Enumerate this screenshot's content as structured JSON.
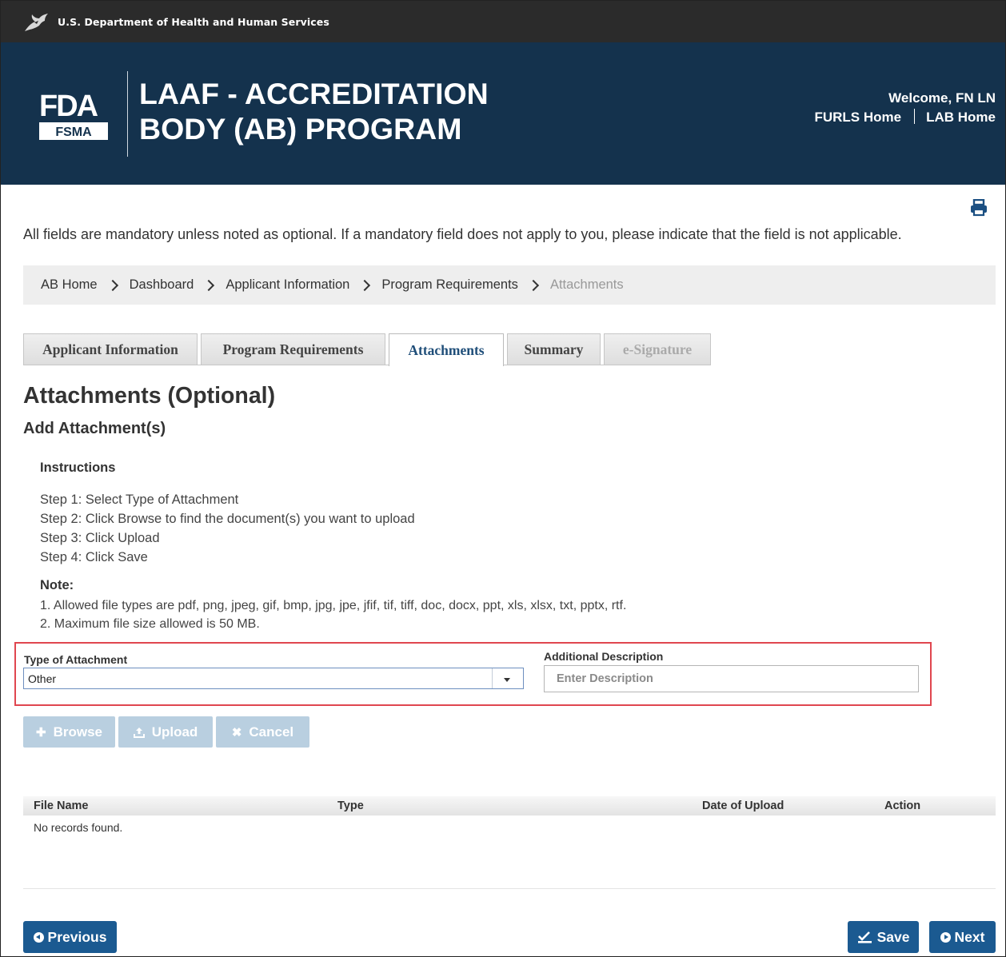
{
  "hhs_bar": {
    "text": "U.S. Department of Health and Human Services",
    "icon": "hhs-eagle-icon"
  },
  "header": {
    "logo": {
      "top": "FDA",
      "bottom": "FSMA"
    },
    "title_line1": "LAAF - ACCREDITATION",
    "title_line2": "BODY (AB) PROGRAM",
    "welcome": "Welcome, FN LN",
    "links": [
      "FURLS Home",
      "LAB Home"
    ]
  },
  "print_icon": "printer-icon",
  "mandatory_note": "All fields are mandatory unless noted as optional. If a mandatory field does not apply to you, please indicate that the field is not applicable.",
  "breadcrumb": [
    "AB Home",
    "Dashboard",
    "Applicant Information",
    "Program Requirements",
    "Attachments"
  ],
  "tabs": [
    {
      "label": "Applicant Information",
      "state": "normal"
    },
    {
      "label": "Program Requirements",
      "state": "normal"
    },
    {
      "label": "Attachments",
      "state": "active"
    },
    {
      "label": "Summary",
      "state": "normal"
    },
    {
      "label": "e-Signature",
      "state": "disabled"
    }
  ],
  "page": {
    "title": "Attachments (Optional)",
    "subtitle": "Add Attachment(s)",
    "instructions_title": "Instructions",
    "steps": [
      "Step 1: Select Type of Attachment",
      "Step 2: Click Browse to find the document(s) you want to upload",
      "Step 3: Click Upload",
      "Step 4: Click Save"
    ],
    "note_title": "Note:",
    "notes": [
      "1. Allowed file types are pdf, png, jpeg, gif, bmp, jpg, jpe, jfif, tif, tiff, doc, docx, ppt, xls, xlsx, txt, pptx, rtf.",
      "2. Maximum file size allowed is 50 MB."
    ]
  },
  "form": {
    "type_label": "Type of Attachment",
    "type_value": "Other",
    "desc_label": "Additional Description",
    "desc_placeholder": "Enter Description",
    "highlight_color": "#e0464f"
  },
  "actions": {
    "browse": "Browse",
    "upload": "Upload",
    "cancel": "Cancel"
  },
  "table": {
    "headers": [
      "File Name",
      "Type",
      "Date of Upload",
      "Action"
    ],
    "empty_text": "No records found."
  },
  "footer": {
    "previous": "Previous",
    "save": "Save",
    "next": "Next"
  },
  "colors": {
    "header_bg": "#14324d",
    "hhs_bg": "#2b2b2b",
    "primary_button": "#1b5a91",
    "disabled_button": "#b9cfe0"
  }
}
